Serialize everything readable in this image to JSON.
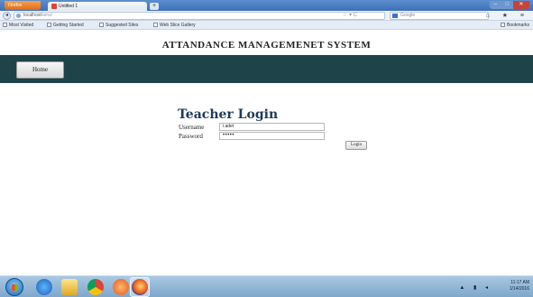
{
  "browser": {
    "menu_label": "Firefox",
    "tab_title": "Untitled 1",
    "new_tab": "+",
    "url_host": "localhost",
    "url_path": "/ams/",
    "search_placeholder": "Google",
    "window_buttons": {
      "minimize": "–",
      "maximize": "□",
      "close": "✕"
    },
    "nav_icons": "⌂ ★ ≡",
    "url_star": "☆ ▾ C"
  },
  "bookmarks": {
    "items": [
      "Most Visited",
      "Getting Started",
      "Suggested Sites",
      "Web Slice Gallery"
    ],
    "right_label": "Bookmarks"
  },
  "page": {
    "site_title": "ATTANDANCE MANAGEMENET SYSTEM",
    "nav_home": "Home",
    "login_title": "Teacher Login",
    "username_label": "Username",
    "password_label": "Password",
    "username_value": "i.adet",
    "password_value": "•••••",
    "login_button": "Login"
  },
  "taskbar": {
    "tray_icons": "▲ ▮ ◂",
    "time": "11:17 AM",
    "date": "1/14/2016"
  },
  "colors": {
    "banner": "#1e4348",
    "title_text": "#1e3a5a",
    "taskbar": "#8fb4d6"
  }
}
